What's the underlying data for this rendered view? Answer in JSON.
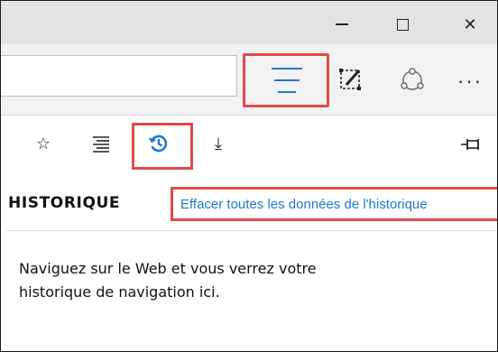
{
  "window": {
    "controls": {
      "minimize_icon": "minimize-icon",
      "maximize_icon": "maximize-icon",
      "close_glyph": "✕"
    }
  },
  "toolbar": {
    "address_value": "",
    "more_label": "···",
    "icons": [
      "hub-icon",
      "web-note-icon",
      "share-icon",
      "more-icon"
    ]
  },
  "hub": {
    "tabs": [
      {
        "name": "favorites",
        "glyph": "☆"
      },
      {
        "name": "reading-list",
        "glyph": ""
      },
      {
        "name": "history",
        "glyph": ""
      },
      {
        "name": "downloads",
        "glyph": "⤓"
      }
    ],
    "history_title": "HISTORIQUE",
    "clear_link": "Effacer toutes les données de l'historique",
    "empty_line1": "Naviguez sur le Web et vous verrez votre",
    "empty_line2": "historique de navigation ici."
  },
  "colors": {
    "accent": "#1e78d0",
    "highlight": "#e24a4a",
    "titlebar": "#e3e3e3",
    "toolbar": "#f2f2f2"
  }
}
